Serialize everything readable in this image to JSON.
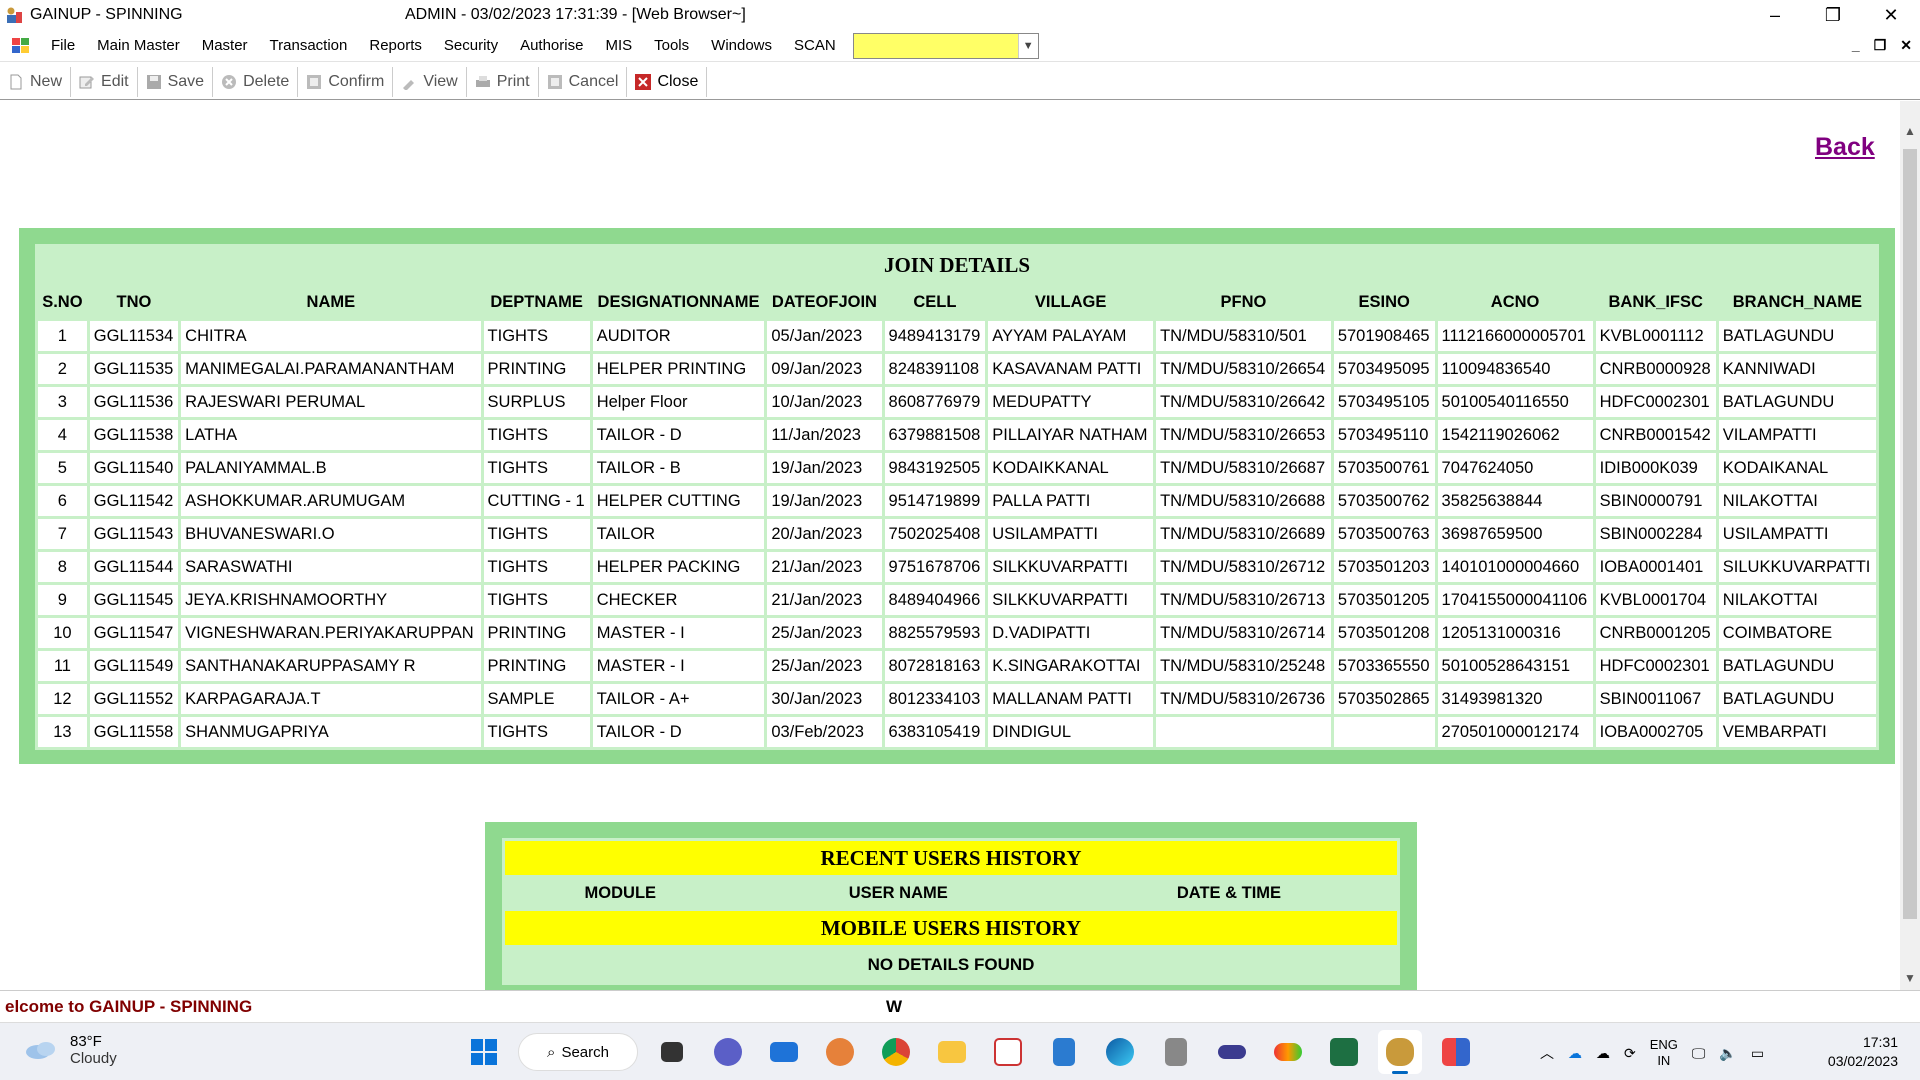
{
  "window": {
    "title": "GAINUP - SPINNING",
    "center_title": "ADMIN - 03/02/2023 17:31:39 - [Web Browser~]",
    "minimize": "–",
    "restore": "❐",
    "close": "✕"
  },
  "menu": {
    "items": [
      "File",
      "Main Master",
      "Master",
      "Transaction",
      "Reports",
      "Security",
      "Authorise",
      "MIS",
      "Tools",
      "Windows",
      "SCAN"
    ],
    "scan_value": "",
    "scan_color": "#ffff66"
  },
  "toolbar": {
    "new": "New",
    "edit": "Edit",
    "save": "Save",
    "delete": "Delete",
    "confirm": "Confirm",
    "view": "View",
    "print": "Print",
    "cancel": "Cancel",
    "close": "Close"
  },
  "back_link": "Back",
  "join": {
    "caption": "JOIN DETAILS",
    "headers": [
      "S.NO",
      "TNO",
      "NAME",
      "DEPTNAME",
      "DESIGNATIONNAME",
      "DATEOFJOIN",
      "CELL",
      "VILLAGE",
      "PFNO",
      "ESINO",
      "ACNO",
      "BANK_IFSC",
      "BRANCH_NAME"
    ],
    "rows": [
      [
        "1",
        "GGL11534",
        "CHITRA",
        "TIGHTS",
        "AUDITOR",
        "05/Jan/2023",
        "9489413179",
        "AYYAM PALAYAM",
        "TN/MDU/58310/501",
        "5701908465",
        "1112166000005701",
        "KVBL0001112",
        "BATLAGUNDU"
      ],
      [
        "2",
        "GGL11535",
        "MANIMEGALAI.PARAMANANTHAM",
        "PRINTING",
        "HELPER PRINTING",
        "09/Jan/2023",
        "8248391108",
        "KASAVANAM PATTI",
        "TN/MDU/58310/26654",
        "5703495095",
        "110094836540",
        "CNRB0000928",
        "KANNIWADI"
      ],
      [
        "3",
        "GGL11536",
        "RAJESWARI PERUMAL",
        "SURPLUS",
        "Helper Floor",
        "10/Jan/2023",
        "8608776979",
        "MEDUPATTY",
        "TN/MDU/58310/26642",
        "5703495105",
        "50100540116550",
        "HDFC0002301",
        "BATLAGUNDU"
      ],
      [
        "4",
        "GGL11538",
        "LATHA",
        "TIGHTS",
        "TAILOR - D",
        "11/Jan/2023",
        "6379881508",
        "PILLAIYAR NATHAM",
        "TN/MDU/58310/26653",
        "5703495110",
        "1542119026062",
        "CNRB0001542",
        "VILAMPATTI"
      ],
      [
        "5",
        "GGL11540",
        "PALANIYAMMAL.B",
        "TIGHTS",
        "TAILOR - B",
        "19/Jan/2023",
        "9843192505",
        "KODAIKKANAL",
        "TN/MDU/58310/26687",
        "5703500761",
        "7047624050",
        "IDIB000K039",
        "KODAIKANAL"
      ],
      [
        "6",
        "GGL11542",
        "ASHOKKUMAR.ARUMUGAM",
        "CUTTING - 1",
        "HELPER CUTTING",
        "19/Jan/2023",
        "9514719899",
        "PALLA PATTI",
        "TN/MDU/58310/26688",
        "5703500762",
        "35825638844",
        "SBIN0000791",
        "NILAKOTTAI"
      ],
      [
        "7",
        "GGL11543",
        "BHUVANESWARI.O",
        "TIGHTS",
        "TAILOR",
        "20/Jan/2023",
        "7502025408",
        "USILAMPATTI",
        "TN/MDU/58310/26689",
        "5703500763",
        "36987659500",
        "SBIN0002284",
        "USILAMPATTI"
      ],
      [
        "8",
        "GGL11544",
        "SARASWATHI",
        "TIGHTS",
        "HELPER PACKING",
        "21/Jan/2023",
        "9751678706",
        "SILKKUVARPATTI",
        "TN/MDU/58310/26712",
        "5703501203",
        "140101000004660",
        "IOBA0001401",
        "SILUKKUVARPATTI"
      ],
      [
        "9",
        "GGL11545",
        "JEYA.KRISHNAMOORTHY",
        "TIGHTS",
        "CHECKER",
        "21/Jan/2023",
        "8489404966",
        "SILKKUVARPATTI",
        "TN/MDU/58310/26713",
        "5703501205",
        "1704155000041106",
        "KVBL0001704",
        "NILAKOTTAI"
      ],
      [
        "10",
        "GGL11547",
        "VIGNESHWARAN.PERIYAKARUPPAN",
        "PRINTING",
        "MASTER - I",
        "25/Jan/2023",
        "8825579593",
        "D.VADIPATTI",
        "TN/MDU/58310/26714",
        "5703501208",
        "1205131000316",
        "CNRB0001205",
        "COIMBATORE"
      ],
      [
        "11",
        "GGL11549",
        "SANTHANAKARUPPASAMY R",
        "PRINTING",
        "MASTER - I",
        "25/Jan/2023",
        "8072818163",
        "K.SINGARAKOTTAI",
        "TN/MDU/58310/25248",
        "5703365550",
        "50100528643151",
        "HDFC0002301",
        "BATLAGUNDU"
      ],
      [
        "12",
        "GGL11552",
        "KARPAGARAJA.T",
        "SAMPLE",
        "TAILOR - A+",
        "30/Jan/2023",
        "8012334103",
        "MALLANAM PATTI",
        "TN/MDU/58310/26736",
        "5703502865",
        "31493981320",
        "SBIN0011067",
        "BATLAGUNDU"
      ],
      [
        "13",
        "GGL11558",
        "SHANMUGAPRIYA",
        "TIGHTS",
        "TAILOR - D",
        "03/Feb/2023",
        "6383105419",
        "DINDIGUL",
        "",
        "",
        "270501000012174",
        "IOBA0002705",
        "VEMBARPATI"
      ]
    ]
  },
  "users": {
    "recent_caption": "RECENT USERS HISTORY",
    "headers": [
      "MODULE",
      "USER NAME",
      "DATE & TIME"
    ],
    "mobile_caption": "MOBILE USERS HISTORY",
    "no_details": "NO DETAILS FOUND"
  },
  "status": {
    "message": "elcome to GAINUP - SPINNING",
    "marker": "W"
  },
  "taskbar": {
    "temp": "83°F",
    "weather": "Cloudy",
    "search": "Search",
    "lang1": "ENG",
    "lang2": "IN",
    "time": "17:31",
    "date": "03/02/2023"
  },
  "colors": {
    "panel_green": "#8fd98f",
    "header_green": "#c8f0c8",
    "highlight_yellow": "#ffff00",
    "back_link": "#800080",
    "status_text": "#800000"
  }
}
